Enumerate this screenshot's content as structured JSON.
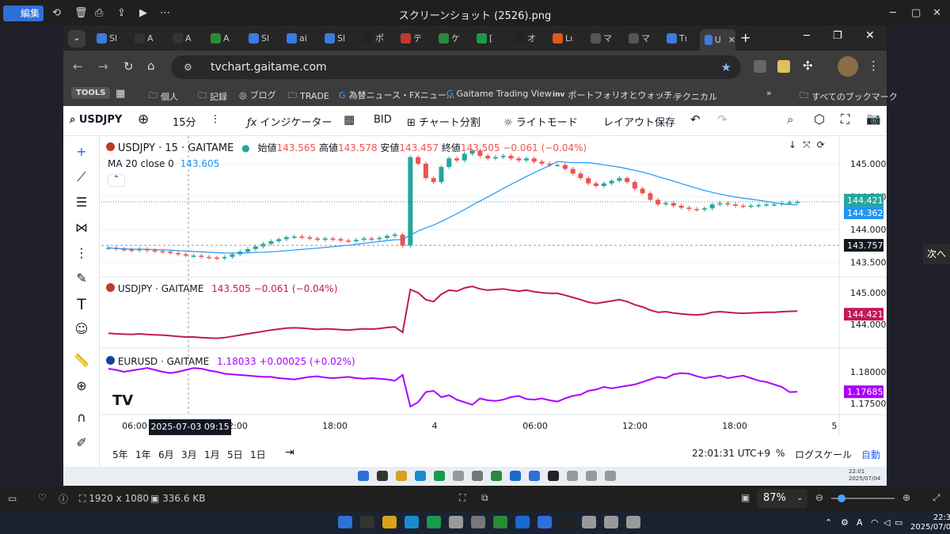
{
  "viewer": {
    "edit": "編集",
    "title": "スクリーンショット (2526).png",
    "dims": "1920 x 1080",
    "size": "336.6 KB",
    "zoom": "87%",
    "next": "次へ"
  },
  "browser": {
    "url": "tvchart.gaitame.com",
    "tabs": [
      "Sl",
      "A",
      "A",
      "A",
      "Sl",
      "ai",
      "Sl",
      "ポ",
      "テ",
      "ケ",
      "[",
      "オ",
      "Lı",
      "マ",
      "マ",
      "Tı",
      "U"
    ],
    "bookmarks": [
      "TOOLS",
      "個人",
      "記録",
      "ブログ",
      "TRADE",
      "為替ニュース・FXニュー...",
      "Gaitame Trading View",
      "ポートフォリオとウォッチ...",
      "テクニカル",
      "すべてのブックマーク"
    ]
  },
  "toolbar": {
    "symbol": "USDJPY",
    "interval": "15分",
    "indicators": "インジケーター",
    "bid": "BID",
    "split": "チャート分割",
    "light": "ライトモード",
    "save": "レイアウト保存"
  },
  "legend": {
    "title": "USDJPY · 15 · GAITAME",
    "o_label": "始値",
    "o": "143.565",
    "h_label": "高値",
    "h": "143.578",
    "l_label": "安値",
    "l": "143.457",
    "c_label": "終値",
    "c": "143.505",
    "chg": "−0.061 (−0.04%)",
    "ma_label": "MA 20 close 0",
    "ma": "143.605"
  },
  "pane2": {
    "title": "USDJPY · GAITAME",
    "val": "143.505",
    "chg": "−0.061 (−0.04%)"
  },
  "pane3": {
    "title": "EURUSD · GAITAME",
    "val": "1.18033",
    "chg": "+0.00025 (+0.02%)"
  },
  "bottom": {
    "ranges": [
      "5年",
      "1年",
      "6月",
      "3月",
      "1月",
      "5日",
      "1日"
    ],
    "time": "22:01:31 UTC+9",
    "pct": "%",
    "log": "ログスケール",
    "auto": "自動",
    "crosshair_time": "2025-07-03   09:15"
  },
  "clock": {
    "inner_time": "22:01",
    "inner_date": "2025/07/04",
    "time": "22:34",
    "date": "2025/07/04"
  },
  "colors": {
    "candle_up": "#26a69a",
    "candle_down": "#ef5350",
    "ma": "#2196f3",
    "usdjpy_line": "#c2185b",
    "eurusd_line": "#aa00ff",
    "accent": "#2962ff"
  },
  "chart_data": [
    {
      "type": "candlestick",
      "title": "USDJPY · 15 · GAITAME",
      "y_ticks": [
        "145.000",
        "144.500",
        "144.000",
        "143.500"
      ],
      "ylim": [
        143.3,
        145.3
      ],
      "x_ticks": [
        "06:00",
        "12:00",
        "18:00",
        "4",
        "06:00",
        "12:00",
        "18:00",
        "5"
      ],
      "price_labels": {
        "last": "144.421",
        "ma": "144.362",
        "crosshair": "143.757"
      },
      "close": [
        143.72,
        143.7,
        143.69,
        143.68,
        143.7,
        143.68,
        143.67,
        143.66,
        143.64,
        143.62,
        143.6,
        143.6,
        143.58,
        143.57,
        143.56,
        143.58,
        143.62,
        143.66,
        143.7,
        143.74,
        143.78,
        143.82,
        143.85,
        143.88,
        143.89,
        143.88,
        143.86,
        143.84,
        143.86,
        143.85,
        143.83,
        143.82,
        143.84,
        143.86,
        143.85,
        143.87,
        143.9,
        143.92,
        143.75,
        145.1,
        145.0,
        144.78,
        144.72,
        144.95,
        145.08,
        145.05,
        145.15,
        145.2,
        145.12,
        145.08,
        145.1,
        145.12,
        145.08,
        145.05,
        145.08,
        145.03,
        145.0,
        144.98,
        144.98,
        144.92,
        144.85,
        144.78,
        144.7,
        144.66,
        144.7,
        144.74,
        144.78,
        144.72,
        144.62,
        144.55,
        144.45,
        144.38,
        144.4,
        144.36,
        144.33,
        144.31,
        144.3,
        144.32,
        144.38,
        144.4,
        144.38,
        144.36,
        144.35,
        144.36,
        144.37,
        144.38,
        144.38,
        144.4,
        144.41,
        144.42
      ]
    },
    {
      "type": "line",
      "title": "USDJPY · GAITAME",
      "y_ticks": [
        "145.000",
        "144.000"
      ],
      "ylim": [
        143.3,
        145.3
      ],
      "last_label": "144.421"
    },
    {
      "type": "line",
      "title": "EURUSD · GAITAME",
      "y_ticks": [
        "1.18000",
        "1.17500"
      ],
      "ylim": [
        1.1735,
        1.183
      ],
      "values": [
        1.1805,
        1.1803,
        1.18,
        1.1802,
        1.1804,
        1.1806,
        1.1803,
        1.18,
        1.1798,
        1.18,
        1.1803,
        1.1806,
        1.1805,
        1.1802,
        1.18,
        1.1797,
        1.1796,
        1.1795,
        1.1794,
        1.1793,
        1.1792,
        1.1792,
        1.179,
        1.1789,
        1.1788,
        1.179,
        1.1792,
        1.1793,
        1.1791,
        1.179,
        1.1791,
        1.1792,
        1.179,
        1.1789,
        1.179,
        1.1789,
        1.1788,
        1.1786,
        1.1795,
        1.1745,
        1.1752,
        1.1768,
        1.177,
        1.176,
        1.1763,
        1.1756,
        1.1752,
        1.1748,
        1.1758,
        1.1755,
        1.1754,
        1.1756,
        1.176,
        1.1762,
        1.1757,
        1.1756,
        1.1758,
        1.1755,
        1.1753,
        1.1758,
        1.1762,
        1.1764,
        1.177,
        1.1772,
        1.1776,
        1.1774,
        1.1776,
        1.1778,
        1.178,
        1.1784,
        1.1788,
        1.1792,
        1.179,
        1.1796,
        1.1798,
        1.1797,
        1.1793,
        1.179,
        1.1792,
        1.1794,
        1.179,
        1.1792,
        1.1794,
        1.179,
        1.1786,
        1.1784,
        1.178,
        1.1776,
        1.1768,
        1.17685
      ],
      "last_label": "1.17685"
    }
  ]
}
